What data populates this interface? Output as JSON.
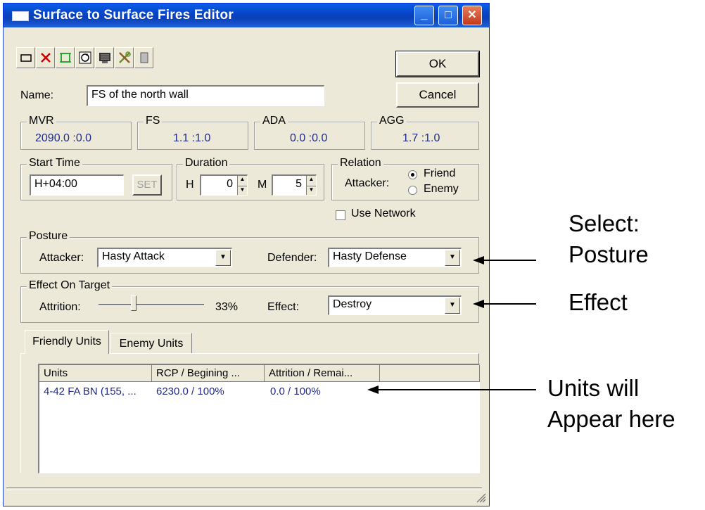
{
  "window": {
    "title": "Surface to Surface Fires Editor"
  },
  "toolbar": {
    "icons": [
      "new-icon",
      "delete-icon",
      "frame-icon",
      "refresh-icon",
      "grid-icon",
      "tools-icon",
      "document-icon"
    ]
  },
  "buttons": {
    "ok": "OK",
    "cancel": "Cancel",
    "set": "SET"
  },
  "name": {
    "label": "Name:",
    "value": "FS of the north wall"
  },
  "ratios": [
    {
      "label": "MVR",
      "value": "2090.0 :0.0"
    },
    {
      "label": "FS",
      "value": "1.1 :1.0"
    },
    {
      "label": "ADA",
      "value": "0.0 :0.0"
    },
    {
      "label": "AGG",
      "value": "1.7 :1.0"
    }
  ],
  "start_time": {
    "label": "Start Time",
    "value": "H+04:00"
  },
  "duration": {
    "label": "Duration",
    "h_label": "H",
    "h_value": "0",
    "m_label": "M",
    "m_value": "5"
  },
  "relation": {
    "label": "Relation",
    "attacker_label": "Attacker:",
    "friend": "Friend",
    "enemy": "Enemy",
    "selected": "Friend"
  },
  "use_network": {
    "label": "Use Network",
    "checked": false
  },
  "posture": {
    "label": "Posture",
    "attacker_label": "Attacker:",
    "attacker_value": "Hasty Attack",
    "defender_label": "Defender:",
    "defender_value": "Hasty Defense"
  },
  "effect_on_target": {
    "label": "Effect On Target",
    "attrition_label": "Attrition:",
    "attrition_value": "33%",
    "attrition_fraction": 0.33,
    "effect_label": "Effect:",
    "effect_value": "Destroy"
  },
  "tabs": [
    "Friendly Units",
    "Enemy Units"
  ],
  "units_table": {
    "columns": [
      "Units",
      "RCP / Begining ...",
      "Attrition / Remai..."
    ],
    "rows": [
      [
        "4-42 FA BN (155, ...",
        "6230.0  /  100%",
        "0.0  /  100%"
      ]
    ]
  },
  "annotations": {
    "posture": [
      "Select:",
      "Posture"
    ],
    "effect": "Effect",
    "units": [
      "Units will",
      "Appear here"
    ]
  },
  "colors": {
    "ratio_text": "#1f2a8a",
    "title_bar": "#0a4fd0"
  }
}
